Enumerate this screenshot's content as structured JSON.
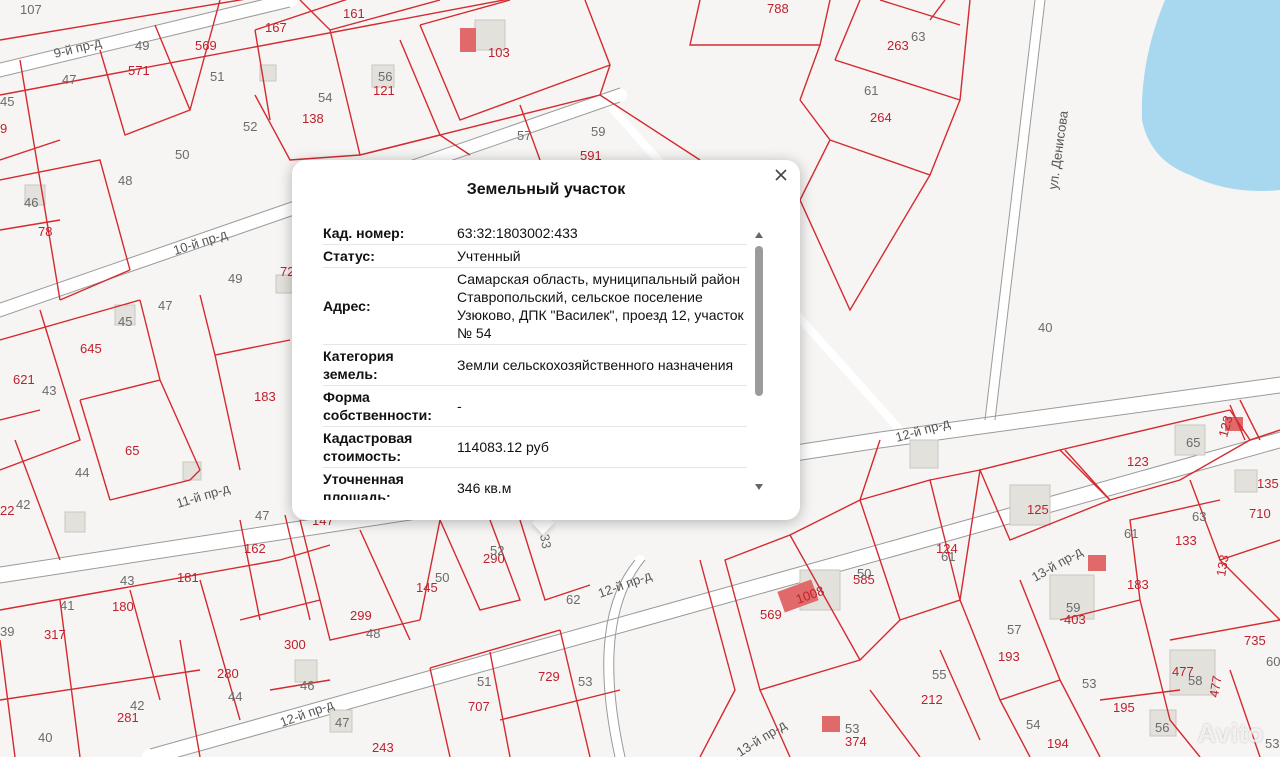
{
  "popup": {
    "title": "Земельный участок",
    "rows": [
      {
        "key": "Кад. номер",
        "value": "63:32:1803002:433"
      },
      {
        "key": "Статус",
        "value": "Учтенный"
      },
      {
        "key": "Адрес",
        "value": "Самарская область, муниципальный район Ставропольский, сельское поселение Узюково, ДПК \"Василек\", проезд 12, участок № 54"
      },
      {
        "key": "Категория земель",
        "value": "Земли сельскохозяйственного назначения"
      },
      {
        "key": "Форма собственности",
        "value": "-"
      },
      {
        "key": "Кадастровая стоимость",
        "value": "114083.12 руб"
      },
      {
        "key": "Уточненная площадь",
        "value": "346 кв.м"
      }
    ],
    "key_suffix": ":",
    "close_icon": "close-icon",
    "scroll_up_icon": "triangle-up-icon",
    "scroll_down_icon": "triangle-down-icon"
  },
  "streets": [
    "9-й пр-д",
    "10-й пр-д",
    "11-й пр-д",
    "12-й пр-д",
    "12-й пр-д",
    "12-й пр-д",
    "13-й пр-д",
    "13-й пр-д",
    "ул. Денисова"
  ],
  "parcel_labels_red": [
    "161",
    "167",
    "788",
    "103",
    "263",
    "569",
    "571",
    "121",
    "138",
    "264",
    "591",
    "9",
    "78",
    "72",
    "645",
    "621",
    "183",
    "65",
    "22",
    "162",
    "181",
    "147",
    "290",
    "145",
    "180",
    "317",
    "299",
    "300",
    "280",
    "281",
    "243",
    "707",
    "729",
    "374",
    "569",
    "1008",
    "585",
    "124",
    "403",
    "183",
    "193",
    "212",
    "194",
    "195",
    "477",
    "477",
    "135",
    "133",
    "133",
    "710",
    "735",
    "123",
    "123",
    "125"
  ],
  "parcel_labels_gray": [
    "107",
    "49",
    "51",
    "47",
    "45",
    "56",
    "54",
    "52",
    "50",
    "48",
    "46",
    "57",
    "59",
    "63",
    "61",
    "49",
    "47",
    "45",
    "43",
    "42",
    "44",
    "47",
    "40",
    "41",
    "43",
    "39",
    "48",
    "46",
    "44",
    "42",
    "47",
    "40",
    "51",
    "53",
    "52",
    "50",
    "62",
    "53",
    "33",
    "65",
    "63",
    "61",
    "57",
    "55",
    "53",
    "54",
    "56",
    "58",
    "59",
    "60",
    "61",
    "53",
    "50"
  ],
  "watermark": "Avito",
  "colors": {
    "parcel_border": "#d42a30",
    "road": "#ffffff",
    "water": "#a8d8f0",
    "building": "#e3e1dc",
    "highlight": "#e06a6a"
  }
}
